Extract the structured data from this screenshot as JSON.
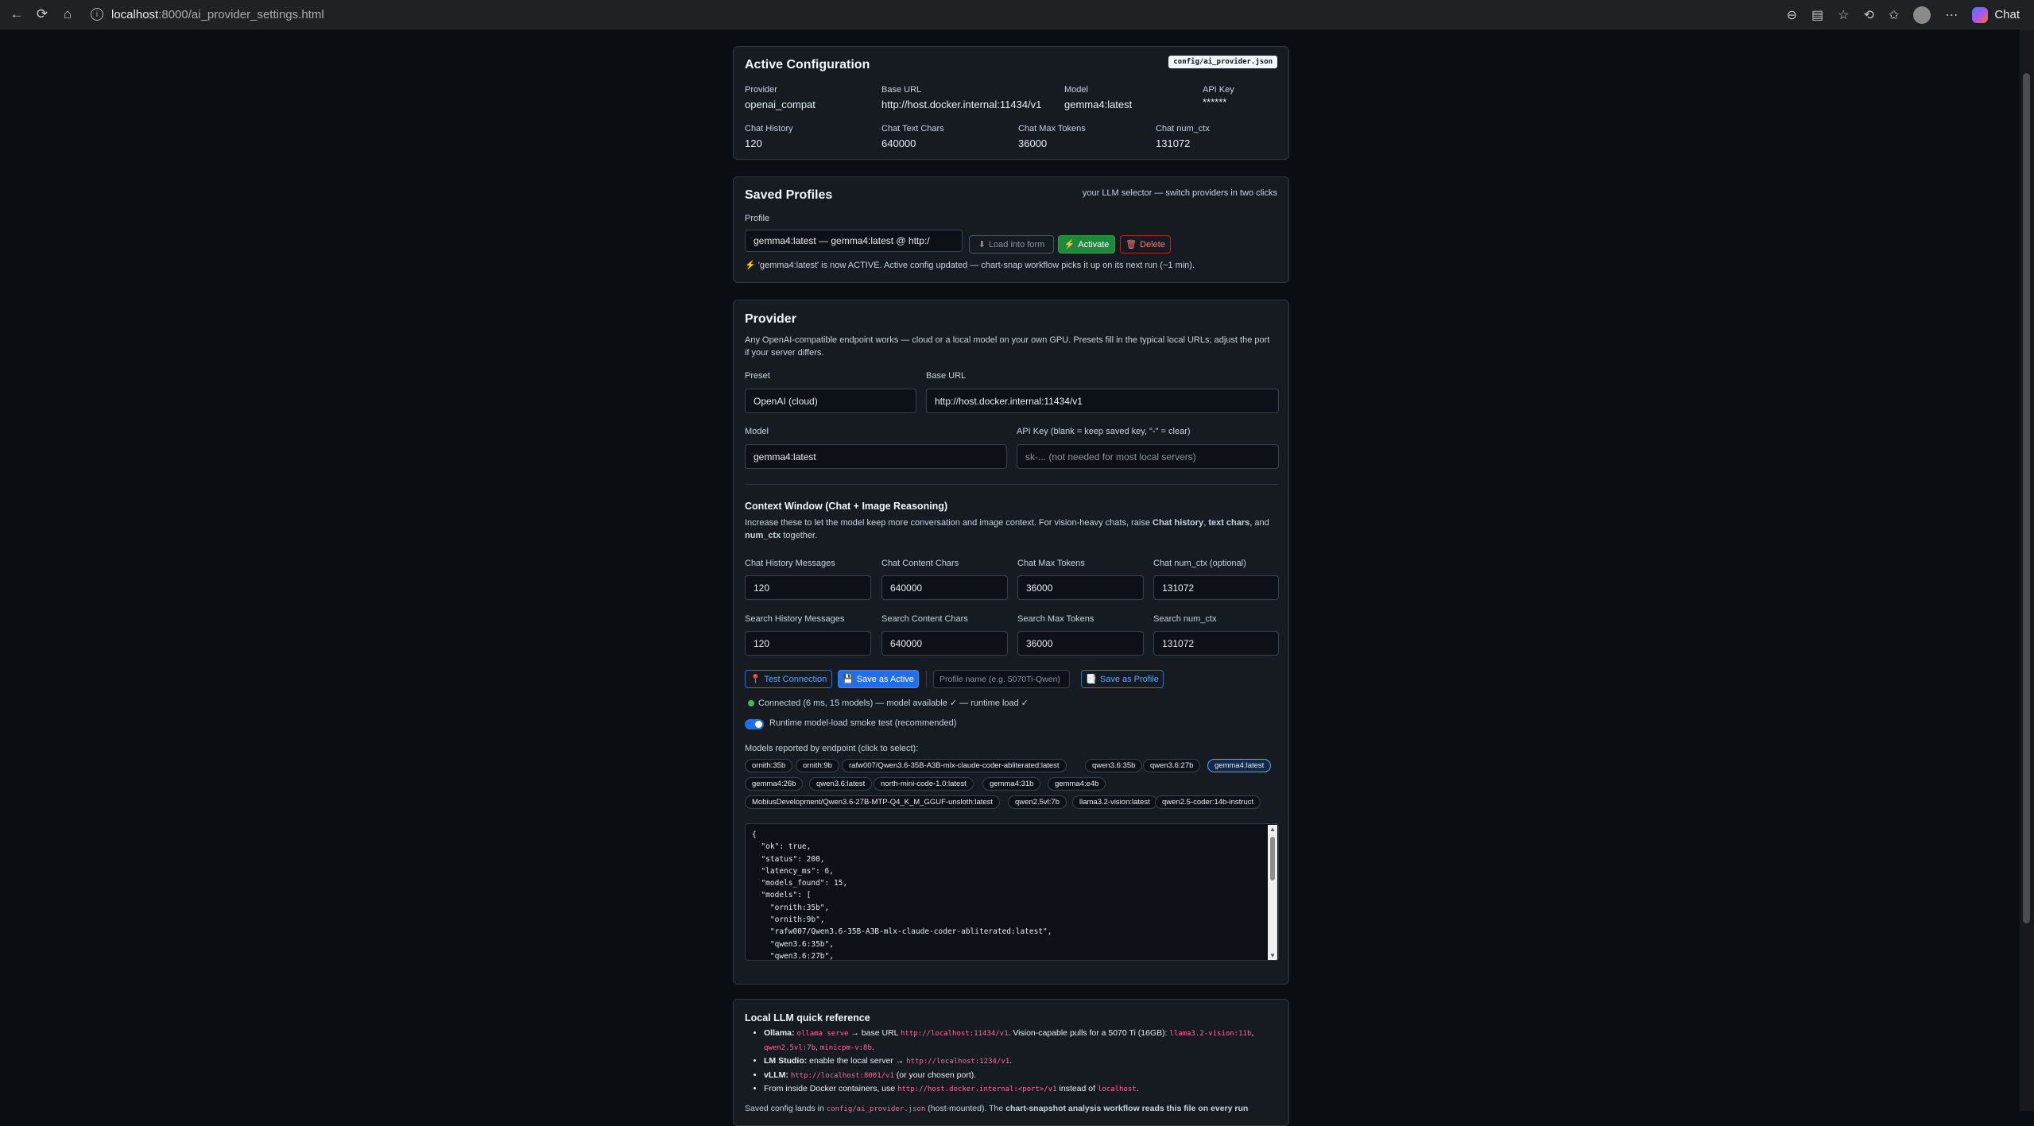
{
  "browser": {
    "url_host": "localhost",
    "url_path": ":8000/ai_provider_settings.html",
    "chat_label": "Chat"
  },
  "active": {
    "title": "Active Configuration",
    "badge": "config/ai_provider.json",
    "fields": [
      {
        "label": "Provider",
        "value": "openai_compat"
      },
      {
        "label": "Base URL",
        "value": "http://host.docker.internal:11434/v1"
      },
      {
        "label": "Model",
        "value": "gemma4:latest"
      },
      {
        "label": "API Key",
        "value": "******"
      },
      {
        "label": "Chat History",
        "value": "120"
      },
      {
        "label": "Chat Text Chars",
        "value": "640000"
      },
      {
        "label": "Chat Max Tokens",
        "value": "36000"
      },
      {
        "label": "Chat num_ctx",
        "value": "131072"
      }
    ]
  },
  "profiles": {
    "title": "Saved Profiles",
    "subtitle": "your LLM selector — switch providers in two clicks",
    "label": "Profile",
    "selected": "gemma4:latest — gemma4:latest @ http:/",
    "load_label": "Load into form",
    "activate_label": "Activate",
    "delete_label": "Delete",
    "status": "'gemma4:latest' is now ACTIVE. Active config updated — chart-snap workflow picks it up on its next run (~1 min)."
  },
  "provider": {
    "title": "Provider",
    "desc_1": "Any OpenAI-compatible endpoint works — cloud or a local model on your own GPU. Presets fill in the typical local URLs; adjust the port",
    "desc_2": "if your server differs.",
    "preset_label": "Preset",
    "preset_value": "OpenAI (cloud)",
    "base_url_label": "Base URL",
    "base_url_value": "http://host.docker.internal:11434/v1",
    "model_label": "Model",
    "model_value": "gemma4:latest",
    "api_key_label": "API Key (blank = keep saved key, \"-\" = clear)",
    "api_key_placeholder": "sk-... (not needed for most local servers)"
  },
  "context": {
    "title": "Context Window (Chat + Image Reasoning)",
    "desc_a": "Increase these to let the model keep more conversation and image context. For vision-heavy chats, raise ",
    "desc_b1": "Chat history",
    "desc_sep1": ", ",
    "desc_b2": "text chars",
    "desc_sep2": ", and",
    "desc_b3": "num_ctx",
    "desc_end": " together.",
    "fields": [
      {
        "label": "Chat History Messages",
        "value": "120"
      },
      {
        "label": "Chat Content Chars",
        "value": "640000"
      },
      {
        "label": "Chat Max Tokens",
        "value": "36000"
      },
      {
        "label": "Chat num_ctx (optional)",
        "value": "131072"
      },
      {
        "label": "Search History Messages",
        "value": "120"
      },
      {
        "label": "Search Content Chars",
        "value": "640000"
      },
      {
        "label": "Search Max Tokens",
        "value": "36000"
      },
      {
        "label": "Search num_ctx",
        "value": "131072"
      }
    ]
  },
  "actions": {
    "test_label": "Test Connection",
    "save_active_label": "Save as Active",
    "profile_name_placeholder": "Profile name (e.g. 5070Ti-Qwen)",
    "save_profile_label": "Save as Profile",
    "connection_status": "Connected (6 ms, 15 models) — model available ✓ — runtime load ✓",
    "toggle_label": "Runtime model-load smoke test (recommended)",
    "models_label": "Models reported by endpoint (click to select):"
  },
  "models": [
    "ornith:35b",
    "ornith:9b",
    "rafw007/Qwen3.6-35B-A3B-mlx-claude-coder-abliterated:latest",
    "qwen3.6:35b",
    "qwen3.6:27b",
    "gemma4:latest",
    "gemma4:26b",
    "qwen3.6:latest",
    "north-mini-code-1.0:latest",
    "gemma4:31b",
    "gemma4:e4b",
    "MobiusDevelopment/Qwen3.6-27B-MTP-Q4_K_M_GGUF-unsloth:latest",
    "qwen2.5vl:7b",
    "llama3.2-vision:latest",
    "qwen2.5-coder:14b-instruct"
  ],
  "selected_model": "gemma4:latest",
  "json_output": "{\n  \"ok\": true,\n  \"status\": 200,\n  \"latency_ms\": 6,\n  \"models_found\": 15,\n  \"models\": [\n    \"ornith:35b\",\n    \"ornith:9b\",\n    \"rafw007/Qwen3.6-35B-A3B-mlx-claude-coder-abliterated:latest\",\n    \"qwen3.6:35b\",\n    \"qwen3.6:27b\",",
  "reference": {
    "title": "Local LLM quick reference",
    "ollama_name": "Ollama:",
    "ollama_cmd": "ollama serve",
    "ollama_mid": " → base URL ",
    "ollama_url": "http://localhost:11434/v1",
    "ollama_text": ". Vision-capable pulls for a 5070 Ti (16GB): ",
    "ollama_m1": "llama3.2-vision:11b",
    "ollama_m2": "qwen2.5vl:7b",
    "ollama_m3": "minicpm-v:8b",
    "lmstudio_name": "LM Studio:",
    "lmstudio_text": " enable the local server → ",
    "lmstudio_url": "http://localhost:1234/v1",
    "vllm_name": "vLLM:",
    "vllm_url": "http://localhost:8001/v1",
    "vllm_text": " (or your chosen port).",
    "docker_text": "From inside Docker containers, use ",
    "docker_url": "http://host.docker.internal:<port>/v1",
    "docker_text2": " instead of ",
    "docker_local": "localhost",
    "footer_a": "Saved config lands in ",
    "footer_code": "config/ai_provider.json",
    "footer_b": " (host-mounted). The ",
    "footer_bold": "chart-snapshot analysis workflow reads this file on every run"
  }
}
